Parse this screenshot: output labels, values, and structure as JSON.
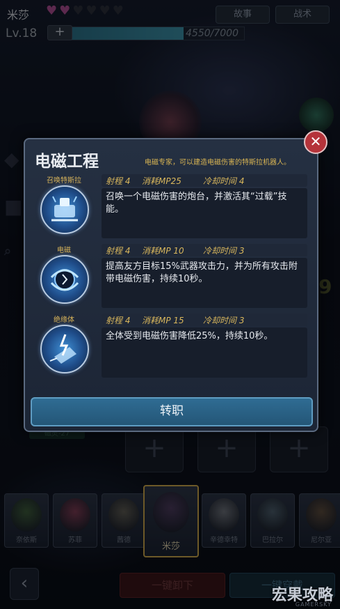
{
  "hud": {
    "char_name": "米莎",
    "hearts": {
      "full": 2,
      "empty": 4
    },
    "level": "Lv.18",
    "exp_text": "4550/7000",
    "exp_progress": 0.65,
    "btn_story": "故事",
    "btn_tactics": "战术"
  },
  "modal": {
    "title": "电磁工程",
    "description": "电磁专家，可以建造电磁伤害的特斯拉机器人。",
    "close_label": "✕",
    "skills": [
      {
        "name": "召唤特斯拉",
        "range": "射程 4",
        "mp": "消耗MP25",
        "cooldown": "冷却时间 4",
        "text": "召唤一个电磁伤害的炮台，并激活其“过载”技能。"
      },
      {
        "name": "电磁",
        "range": "射程 4",
        "mp": "消耗MP 10",
        "cooldown": "冷却时间 3",
        "text": "提高友方目标15%武器攻击力，并为所有攻击附带电磁伤害，持续10秒。"
      },
      {
        "name": "绝缘体",
        "range": "射程 4",
        "mp": "消耗MP 15",
        "cooldown": "冷却时间 3",
        "text": "全体受到电磁伤害降低25%，持续10秒。"
      }
    ],
    "promote_label": "转职"
  },
  "roster": {
    "tag": "磁灵-27",
    "heroes": [
      "奈依斯",
      "苏菲",
      "茜德",
      "米莎",
      "辛德幸特",
      "巴拉尔",
      "尼尔亚"
    ],
    "selected_index": 3
  },
  "bottom": {
    "back_label": "‹",
    "unload_label": "一键卸下",
    "equip_label": "一键穿戴",
    "watermark": "宏果攻略",
    "watermark_sub": "GAMERSKY"
  },
  "colors": {
    "accent_gold": "#d8b65c",
    "modal_bg": "#253042",
    "promote_blue": "#2f6c93",
    "close_red": "#b5333a"
  }
}
